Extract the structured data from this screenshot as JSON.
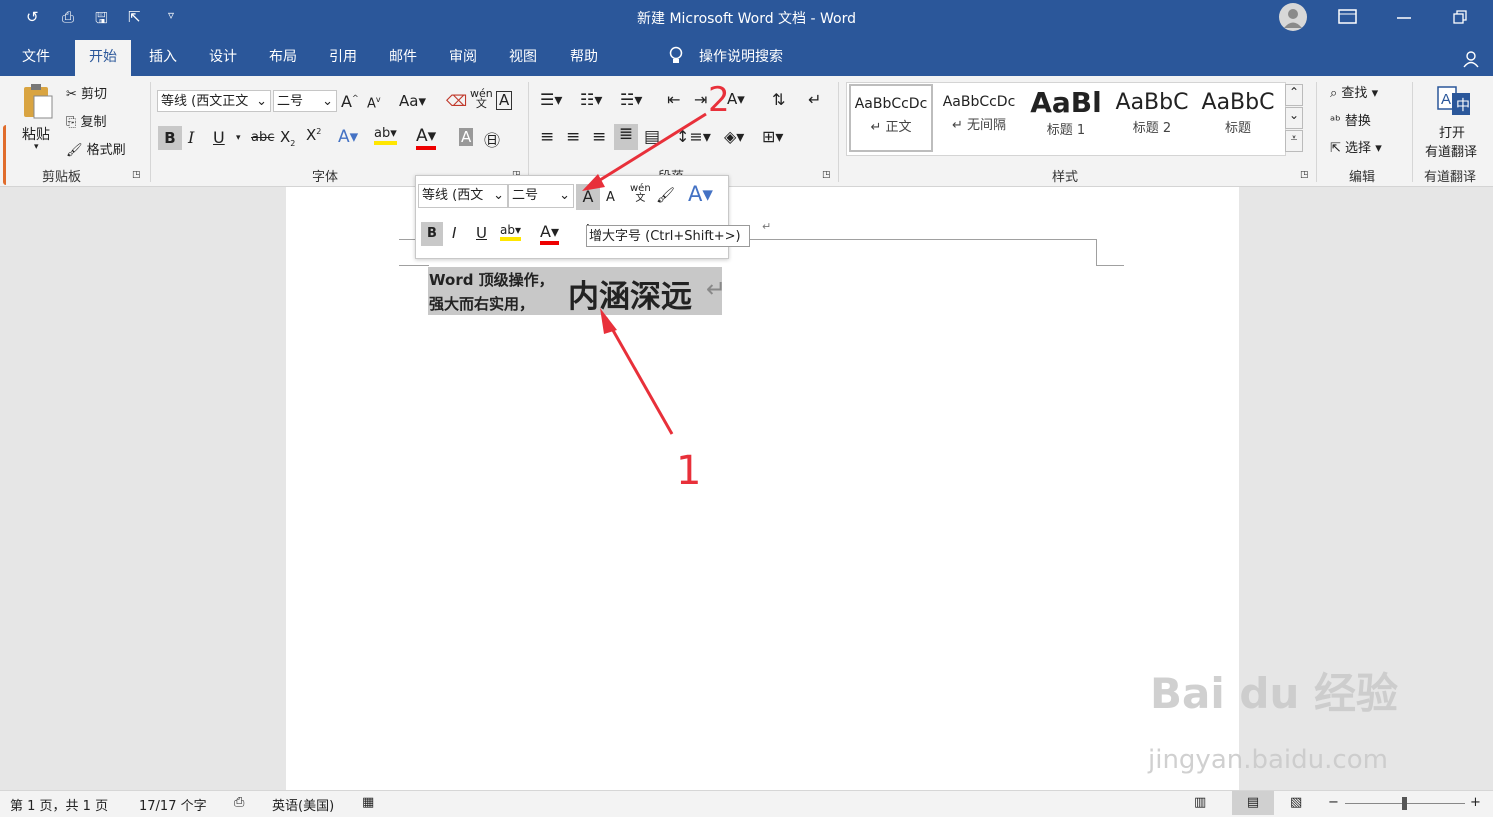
{
  "title_bar": {
    "doc_title": "新建 Microsoft Word 文档  -  Word",
    "quick_access": [
      "↺",
      "⎙",
      "🖫",
      "⇱",
      "▿"
    ]
  },
  "tabs": [
    "文件",
    "开始",
    "插入",
    "设计",
    "布局",
    "引用",
    "邮件",
    "审阅",
    "视图",
    "帮助"
  ],
  "tell_me": "操作说明搜索",
  "clipboard": {
    "paste": "粘贴",
    "cut": "剪切",
    "copy": "复制",
    "painter": "格式刷",
    "label": "剪贴板"
  },
  "font": {
    "name": "等线 (西文正文",
    "size": "二号",
    "label": "字体"
  },
  "paragraph": {
    "label": "段落"
  },
  "styles": {
    "label": "样式",
    "items": [
      {
        "sample": "AaBbCcDc",
        "name": "↵ 正文"
      },
      {
        "sample": "AaBbCcDc",
        "name": "↵ 无间隔"
      },
      {
        "sample": "AaBl",
        "name": "标题 1"
      },
      {
        "sample": "AaBbC",
        "name": "标题 2"
      },
      {
        "sample": "AaBbC",
        "name": "标题"
      }
    ]
  },
  "editing": {
    "find": "查找",
    "replace": "替换",
    "select": "选择",
    "label": "编辑"
  },
  "translate": {
    "open": "打开",
    "youdao": "有道翻译",
    "label": "有道翻译"
  },
  "mini_toolbar": {
    "font": "等线 (西文",
    "size": "二号"
  },
  "tooltip": "增大字号 (Ctrl+Shift+>)",
  "document": {
    "line1": "Word 顶级操作，",
    "line2": "强大而右实用，",
    "big": "内涵深远"
  },
  "annotations": {
    "arrow1": "1",
    "arrow2": "2"
  },
  "status": {
    "page": "第 1 页，共 1 页",
    "words": "17/17 个字",
    "lang": "英语(美国)"
  },
  "watermark": {
    "brand": "Bai  du 经验",
    "url": "jingyan.baidu.com"
  },
  "colors": {
    "accent": "#2b579a",
    "arrow": "#e8303a"
  }
}
